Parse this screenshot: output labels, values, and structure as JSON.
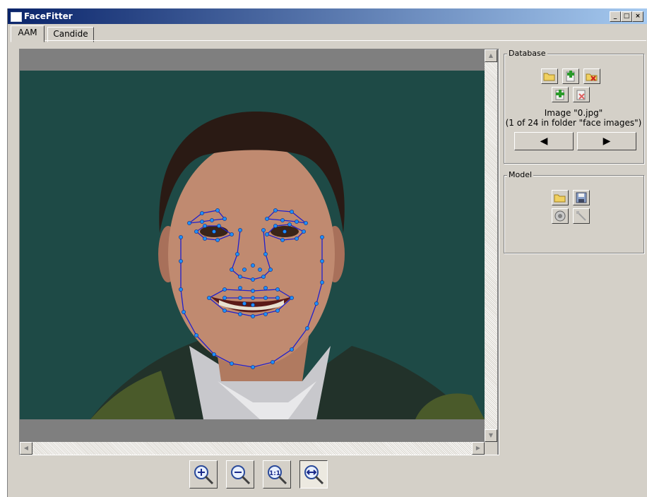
{
  "window": {
    "title": "FaceFitter",
    "controls": [
      "minimize",
      "maximize",
      "close"
    ]
  },
  "tabs": [
    {
      "label": "AAM",
      "active": true
    },
    {
      "label": "Candide",
      "active": false
    }
  ],
  "database": {
    "title": "Database",
    "image_line1": "Image \"0.jpg\"",
    "image_line2": "(1 of 24 in folder \"face images\")",
    "buttons": [
      "open-folder-icon",
      "add-image-icon",
      "delete-image-icon",
      "add-icon",
      "remove-icon"
    ],
    "prev_label": "◀",
    "next_label": "▶"
  },
  "model": {
    "title": "Model",
    "buttons": [
      "open-model-icon",
      "save-model-icon",
      "settings-icon",
      "fit-icon"
    ]
  },
  "zoom": {
    "buttons": [
      "zoom-in-icon",
      "zoom-out-icon",
      "zoom-actual-size-icon",
      "zoom-fit-width-icon"
    ],
    "active": "zoom-fit-width-icon"
  },
  "colors": {
    "title_bar": "#0a246a",
    "background": "#d4d0c8",
    "landmarks": "#1e90ff",
    "mesh": "#2020cc",
    "photo_bg": "#1e4a46"
  }
}
